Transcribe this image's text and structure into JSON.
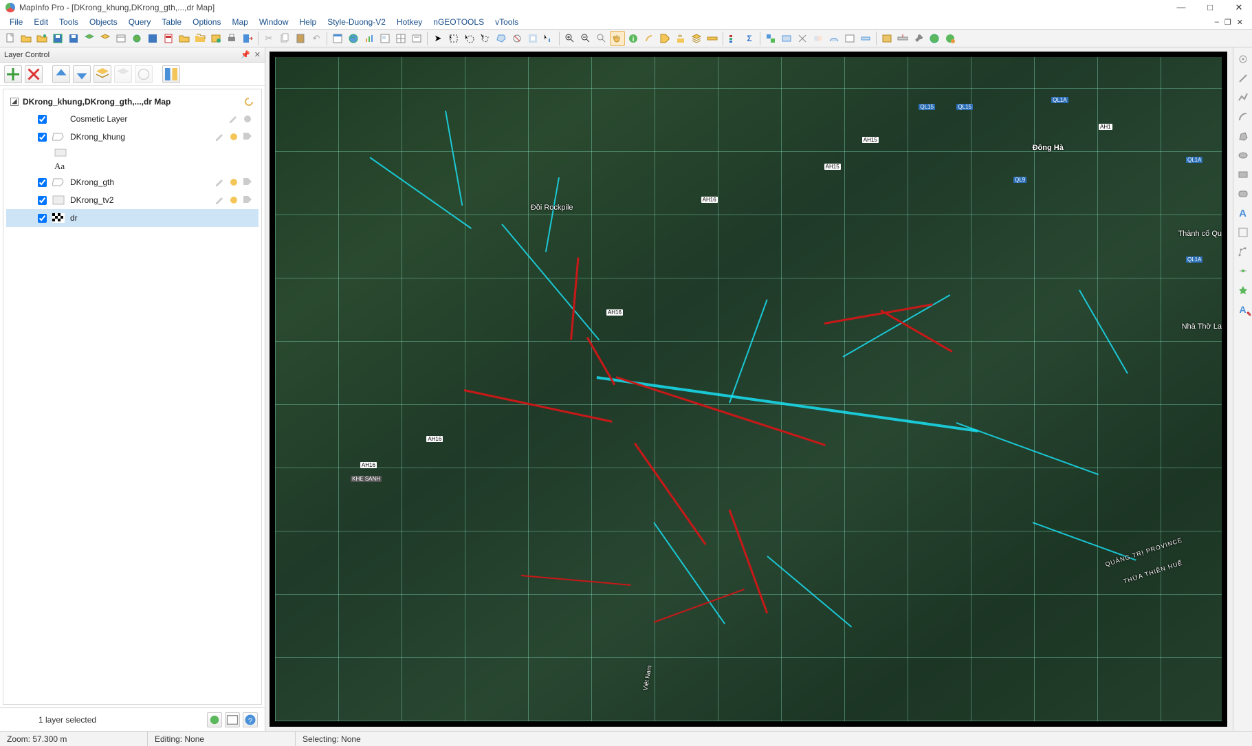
{
  "title": "MapInfo Pro - [DKrong_khung,DKrong_gth,...,dr Map]",
  "menubar": [
    "File",
    "Edit",
    "Tools",
    "Objects",
    "Query",
    "Table",
    "Options",
    "Map",
    "Window",
    "Help",
    "Style-Duong-V2",
    "Hotkey",
    "nGEOTOOLS",
    "vTools"
  ],
  "panel": {
    "title": "Layer Control",
    "group_label": "DKrong_khung,DKrong_gth,...,dr Map",
    "layers": [
      {
        "checked": true,
        "name": "Cosmetic Layer",
        "icon": "blank"
      },
      {
        "checked": true,
        "name": "DKrong_khung",
        "icon": "poly"
      },
      {
        "checked": true,
        "name": "DKrong_gth",
        "icon": "poly"
      },
      {
        "checked": true,
        "name": "DKrong_tv2",
        "icon": "region"
      },
      {
        "checked": true,
        "name": "dr",
        "icon": "raster",
        "selected": true
      }
    ],
    "sublabel": "Aa",
    "footer": "1 layer selected"
  },
  "statusbar": {
    "zoom": "Zoom: 57.300 m",
    "editing": "Editing: None",
    "selecting": "Selecting: None"
  },
  "map_labels": {
    "rockpile": "Đồi Rockpile",
    "dongha": "Đông Hà",
    "thanhco": "Thành cổ Qu",
    "nhatho": "Nhà Thờ La",
    "province": "QUẢNG TRỊ PROVINCE",
    "province2": "THỪA THIÊN HUẾ",
    "ql1a": "QL1A",
    "ql15": "QL15",
    "ql9": "QL9",
    "ah1": "AH1",
    "ah15": "AH15",
    "ah16": "AH16",
    "khesanh": "KHE SANH",
    "vietnam": "Việt Nam"
  },
  "icons": {
    "minimize": "—",
    "maximize": "□",
    "close": "✕",
    "pin": "⇲",
    "x": "✕"
  }
}
